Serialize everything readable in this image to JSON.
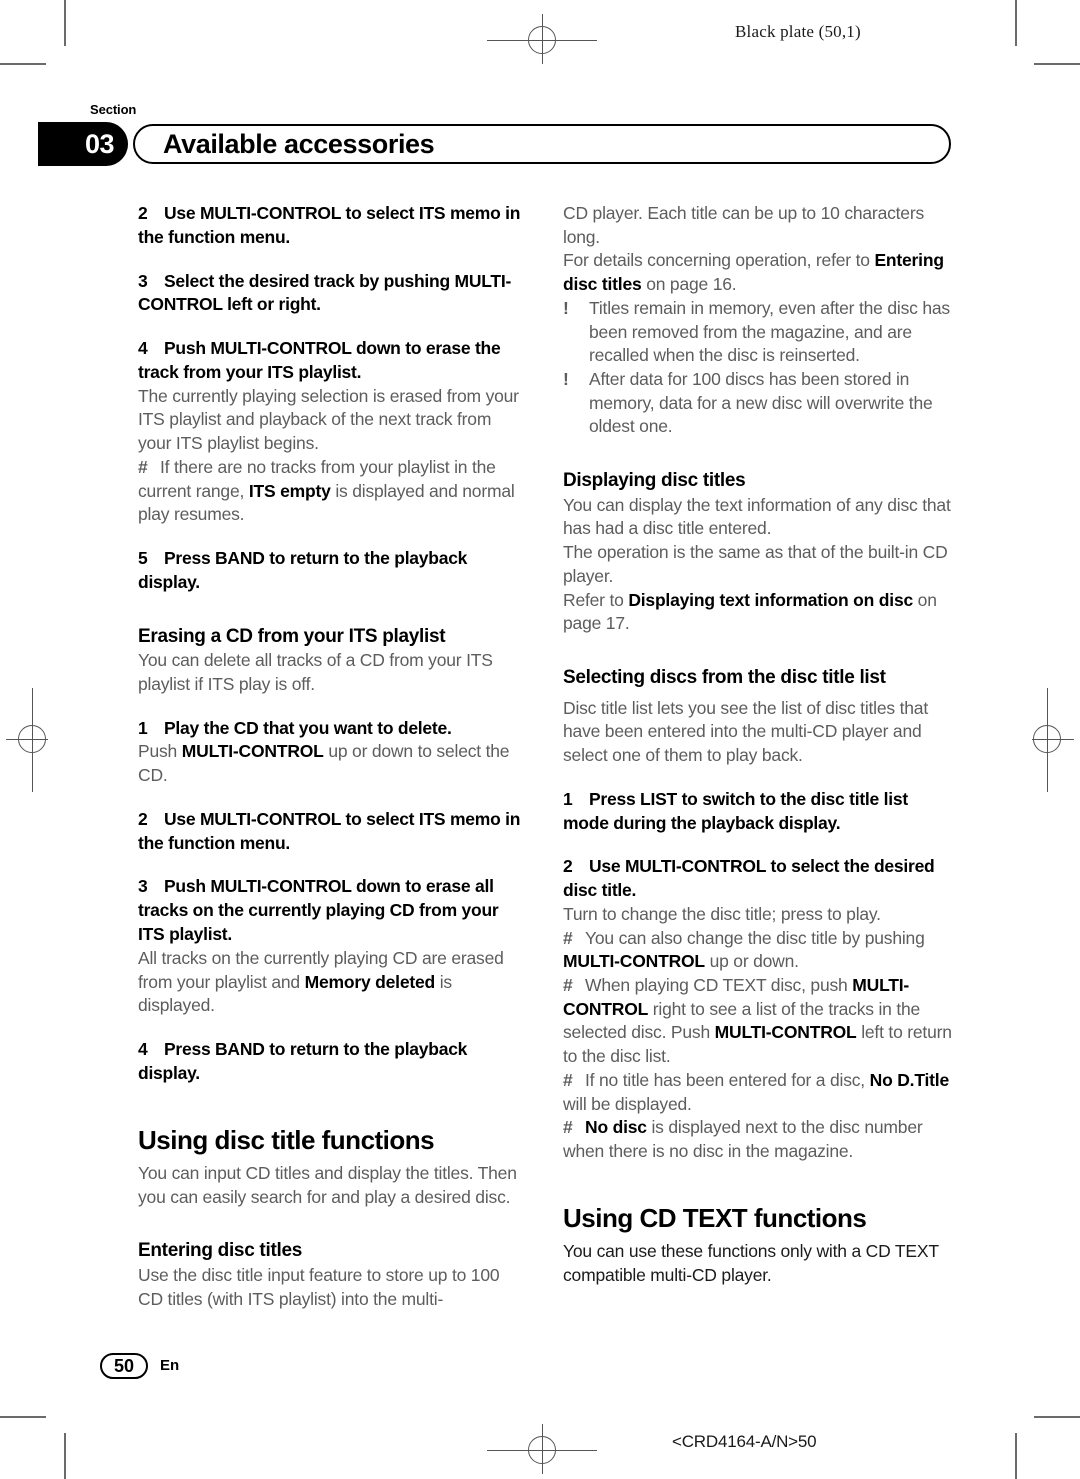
{
  "print_marks": {
    "plate_label": "Black plate (50,1)",
    "doc_code": "<CRD4164-A/N>50"
  },
  "header": {
    "section_word": "Section",
    "section_number": "03",
    "chapter_title": "Available accessories"
  },
  "footer": {
    "page_number": "50",
    "language": "En"
  },
  "left_column": {
    "step2": {
      "number": "2",
      "text": "Use MULTI-CONTROL to select ITS memo in the function menu."
    },
    "step3": {
      "number": "3",
      "text": "Select the desired track by pushing MULTI-CONTROL left or right."
    },
    "step4": {
      "number": "4",
      "text": "Push MULTI-CONTROL down to erase the track from your ITS playlist."
    },
    "step4_body": "The currently playing selection is erased from your ITS playlist and playback of the next track from your ITS playlist begins.",
    "note1": {
      "marker": "#",
      "part1": "If there are no tracks from your playlist in the current range, ",
      "bold": "ITS empty",
      "part2": " is displayed and normal play resumes."
    },
    "step5": {
      "number": "5",
      "text": "Press BAND to return to the playback display."
    },
    "heading_erasing_cd": "Erasing a CD from your ITS playlist",
    "erasing_cd_body": "You can delete all tracks of a CD from your ITS playlist if ITS play is off.",
    "e_step1": {
      "number": "1",
      "text": "Play the CD that you want to delete."
    },
    "e_step1_body": {
      "part1": "Push ",
      "bold": "MULTI-CONTROL",
      "part2": " up or down to select the CD."
    },
    "e_step2": {
      "number": "2",
      "text": "Use MULTI-CONTROL to select ITS memo in the function menu."
    },
    "e_step3": {
      "number": "3",
      "text": "Push MULTI-CONTROL down to erase all tracks on the currently playing CD from your ITS playlist."
    },
    "e_step3_body": {
      "part1": "All tracks on the currently playing CD are erased from your playlist and ",
      "bold": "Memory deleted",
      "part2": " is displayed."
    },
    "e_step4": {
      "number": "4",
      "text": "Press BAND to return to the playback display."
    },
    "heading_using_disc_title": "Using disc title functions",
    "using_disc_title_body": "You can input CD titles and display the titles. Then you can easily search for and play a desired disc.",
    "heading_entering_disc_titles": "Entering disc titles",
    "entering_disc_titles_body": "Use the disc title input feature to store up to 100 CD titles  (with ITS playlist) into the multi-"
  },
  "right_column": {
    "continued_body": "CD player. Each title can be up to 10 characters long.",
    "refer_line": {
      "part1": "For details concerning operation, refer to ",
      "bold": "Entering disc titles",
      "part2": " on page 16."
    },
    "bullet1": {
      "marker": "!",
      "text": "Titles remain in memory, even after the disc has been removed from the magazine, and are recalled when the disc is reinserted."
    },
    "bullet2": {
      "marker": "!",
      "text": "After data for 100 discs has been stored in memory, data for a new disc will overwrite the oldest one."
    },
    "heading_displaying_disc_titles": "Displaying disc titles",
    "displaying_body1": "You can display the text information of any disc that has had a disc title entered.",
    "displaying_body2": "The operation is the same as that of the built-in CD player.",
    "displaying_refer": {
      "part1": "Refer to ",
      "bold": "Displaying text information on disc",
      "part2": " on page 17."
    },
    "heading_selecting_discs": "Selecting discs from the disc title list",
    "selecting_body": "Disc title list lets you see the list of disc titles that have been entered into the multi-CD player and select one of them to play back.",
    "s_step1": {
      "number": "1",
      "text": "Press LIST to switch to the disc title list mode during the playback display."
    },
    "s_step2": {
      "number": "2",
      "text": "Use MULTI-CONTROL to select the desired disc title."
    },
    "s_step2_body": "Turn to change the disc title; press to play.",
    "note_a": {
      "marker": "#",
      "part1": "You can also change the disc title by pushing ",
      "bold": "MULTI-CONTROL",
      "part2": " up or down."
    },
    "note_b": {
      "marker": "#",
      "part1": "When playing CD TEXT disc, push ",
      "bold1": "MULTI-CONTROL",
      "part2": " right to see a list of the tracks in the selected disc. Push ",
      "bold2": "MULTI-CONTROL",
      "part3": " left to return to the disc list."
    },
    "note_c": {
      "marker": "#",
      "part1": "If no title has been entered for a disc, ",
      "bold": "No D.Title",
      "part2": " will be displayed."
    },
    "note_d": {
      "marker": "#",
      "bold": "No disc",
      "part2": " is displayed next to the disc number when there is no disc in the magazine."
    },
    "heading_using_cd_text": "Using CD TEXT functions",
    "using_cd_text_body": "You can use these functions only with a CD TEXT compatible multi-CD player."
  }
}
